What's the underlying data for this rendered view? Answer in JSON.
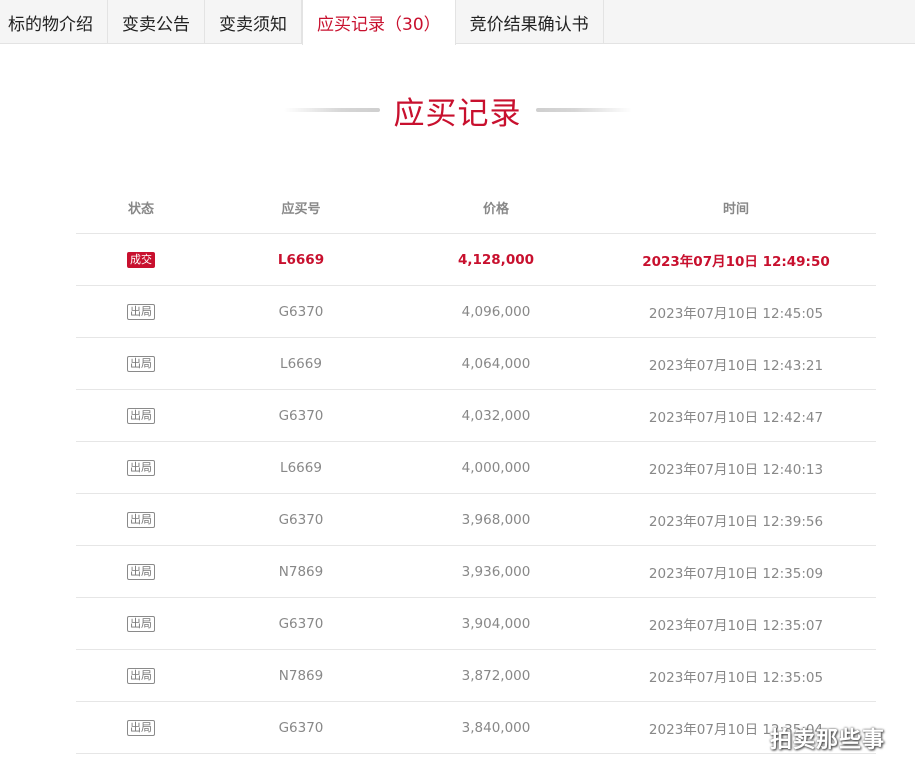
{
  "tabs": [
    {
      "label": "标的物介绍",
      "active": false
    },
    {
      "label": "变卖公告",
      "active": false
    },
    {
      "label": "变卖须知",
      "active": false
    },
    {
      "label": "应买记录（30）",
      "active": true
    },
    {
      "label": "竞价结果确认书",
      "active": false
    }
  ],
  "section_title": "应买记录",
  "table": {
    "headers": {
      "status": "状态",
      "bidder_id": "应买号",
      "price": "价格",
      "time": "时间"
    },
    "rows": [
      {
        "status": "成交",
        "bidder_id": "L6669",
        "price": "4,128,000",
        "time": "2023年07月10日 12:49:50"
      },
      {
        "status": "出局",
        "bidder_id": "G6370",
        "price": "4,096,000",
        "time": "2023年07月10日 12:45:05"
      },
      {
        "status": "出局",
        "bidder_id": "L6669",
        "price": "4,064,000",
        "time": "2023年07月10日 12:43:21"
      },
      {
        "status": "出局",
        "bidder_id": "G6370",
        "price": "4,032,000",
        "time": "2023年07月10日 12:42:47"
      },
      {
        "status": "出局",
        "bidder_id": "L6669",
        "price": "4,000,000",
        "time": "2023年07月10日 12:40:13"
      },
      {
        "status": "出局",
        "bidder_id": "G6370",
        "price": "3,968,000",
        "time": "2023年07月10日 12:39:56"
      },
      {
        "status": "出局",
        "bidder_id": "N7869",
        "price": "3,936,000",
        "time": "2023年07月10日 12:35:09"
      },
      {
        "status": "出局",
        "bidder_id": "G6370",
        "price": "3,904,000",
        "time": "2023年07月10日 12:35:07"
      },
      {
        "status": "出局",
        "bidder_id": "N7869",
        "price": "3,872,000",
        "time": "2023年07月10日 12:35:05"
      },
      {
        "status": "出局",
        "bidder_id": "G6370",
        "price": "3,840,000",
        "time": "2023年07月10日 12:35:04"
      }
    ]
  },
  "watermark": "拍卖那些事",
  "colors": {
    "accent": "#c8102e",
    "muted_text": "#888888",
    "border": "#e6e6e6"
  }
}
